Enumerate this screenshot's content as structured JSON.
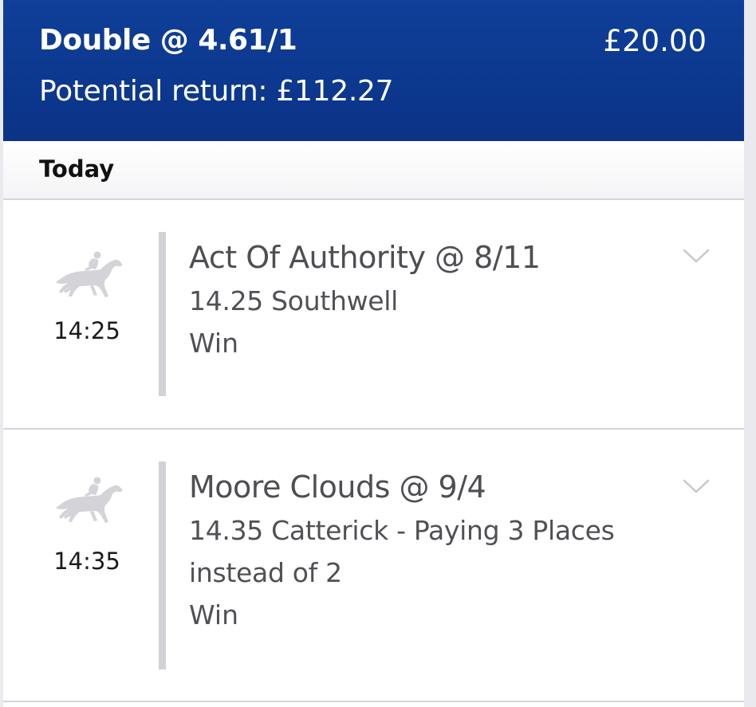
{
  "bet": {
    "title": "Double @ 4.61/1",
    "stake": "£20.00",
    "potential_return": "Potential return: £112.27",
    "header_color": "#0f3f99"
  },
  "day_label": "Today",
  "selections": [
    {
      "icon": "horse-racing-icon",
      "time": "14:25",
      "name": "Act Of Authority @ 8/11",
      "race": "14.25 Southwell",
      "market": "Win"
    },
    {
      "icon": "horse-racing-icon",
      "time": "14:35",
      "name": "Moore Clouds @ 9/4",
      "race": "14.35 Catterick - Paying 3 Places instead of 2",
      "market": "Win"
    }
  ]
}
